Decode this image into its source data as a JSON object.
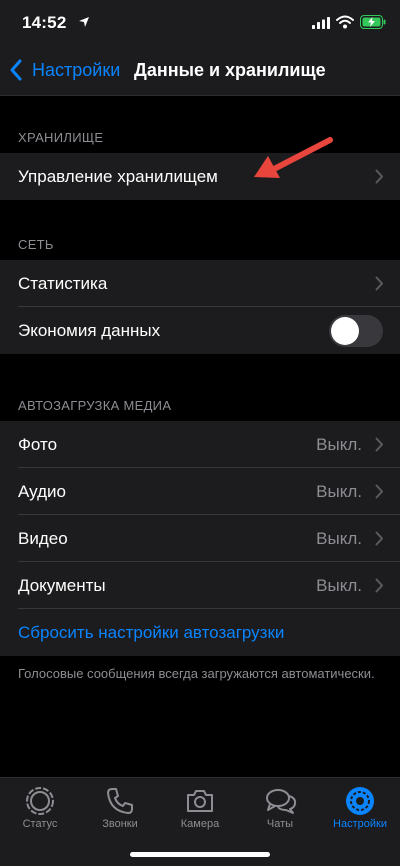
{
  "status_bar": {
    "time": "14:52"
  },
  "nav": {
    "back_label": "Настройки",
    "title": "Данные и хранилище"
  },
  "sections": {
    "storage": {
      "header": "ХРАНИЛИЩЕ",
      "manage_label": "Управление хранилищем"
    },
    "network": {
      "header": "СЕТЬ",
      "stats_label": "Статистика",
      "data_saver_label": "Экономия данных",
      "data_saver_on": false
    },
    "media_autodownload": {
      "header": "АВТОЗАГРУЗКА МЕДИА",
      "items": [
        {
          "label": "Фото",
          "value": "Выкл."
        },
        {
          "label": "Аудио",
          "value": "Выкл."
        },
        {
          "label": "Видео",
          "value": "Выкл."
        },
        {
          "label": "Документы",
          "value": "Выкл."
        }
      ],
      "reset_label": "Сбросить настройки автозагрузки",
      "footer": "Голосовые сообщения всегда загружаются автоматически."
    }
  },
  "tab_bar": {
    "tabs": [
      {
        "label": "Статус",
        "icon": "status-icon"
      },
      {
        "label": "Звонки",
        "icon": "phone-icon"
      },
      {
        "label": "Камера",
        "icon": "camera-icon"
      },
      {
        "label": "Чаты",
        "icon": "chats-icon"
      },
      {
        "label": "Настройки",
        "icon": "gear-icon",
        "active": true
      }
    ]
  },
  "colors": {
    "accent": "#0a84ff",
    "annotation_arrow": "#e8453c",
    "battery_charging": "#34c759"
  }
}
